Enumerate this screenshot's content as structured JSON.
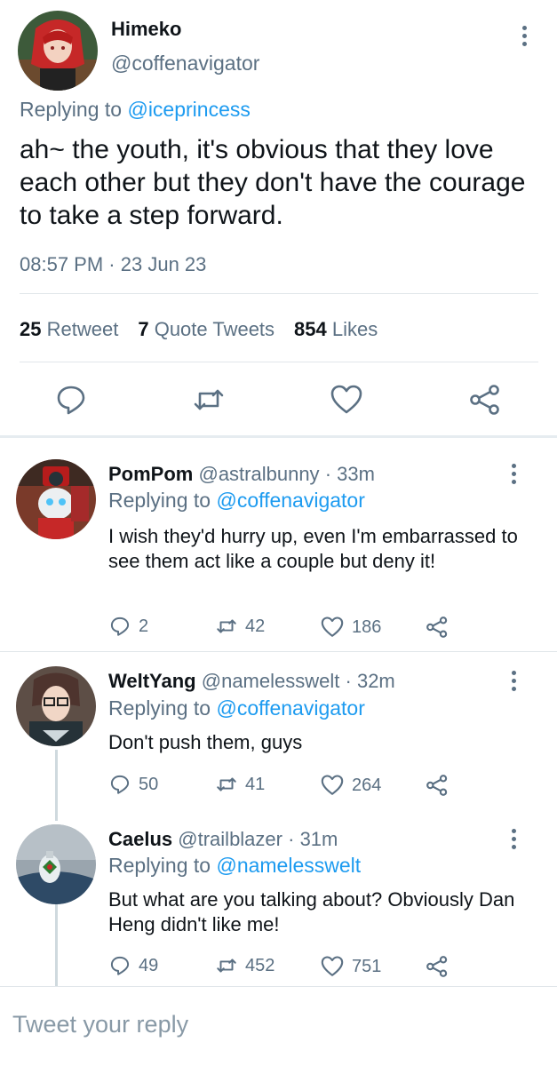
{
  "main_tweet": {
    "name": "Himeko",
    "handle": "@coffenavigator",
    "replying_prefix": "Replying to ",
    "replying_to": "@iceprincess",
    "text": "ah~ the youth, it's obvious that they love each other but they don't have the courage to take a step forward.",
    "time": "08:57 PM",
    "dot": "·",
    "date": "23 Jun 23",
    "stats": {
      "retweet_count": "25",
      "retweet_label": "Retweet",
      "quote_count": "7",
      "quote_label": "Quote Tweets",
      "likes_count": "854",
      "likes_label": "Likes"
    },
    "actions": [
      "reply-icon",
      "retweet-icon",
      "like-icon",
      "share-icon"
    ]
  },
  "replies": [
    {
      "name": "PomPom",
      "handle": "@astralbunny",
      "dot": "·",
      "time": "33m",
      "replying_prefix": "Replying to ",
      "replying_to": "@coffenavigator",
      "text": "I wish they'd hurry up, even I'm embarrassed to see them act like a couple but deny it!",
      "replies": "2",
      "retweets": "42",
      "likes": "186"
    },
    {
      "name": "WeltYang",
      "handle": "@namelesswelt",
      "dot": "·",
      "time": "32m",
      "replying_prefix": "Replying to ",
      "replying_to": "@coffenavigator",
      "text": "Don't push them, guys",
      "replies": "50",
      "retweets": "41",
      "likes": "264"
    },
    {
      "name": "Caelus",
      "handle": "@trailblazer",
      "dot": "·",
      "time": "31m",
      "replying_prefix": "Replying to ",
      "replying_to": "@namelesswelt",
      "text": "But what are you talking about? Obviously Dan Heng didn't like me!",
      "replies": "49",
      "retweets": "452",
      "likes": "751"
    }
  ],
  "compose": {
    "placeholder": "Tweet your reply"
  },
  "colors": {
    "accent": "#1d9bf0",
    "secondary_text": "#5b7083",
    "primary_text": "#0f1419",
    "divider": "#e1e6ea"
  }
}
